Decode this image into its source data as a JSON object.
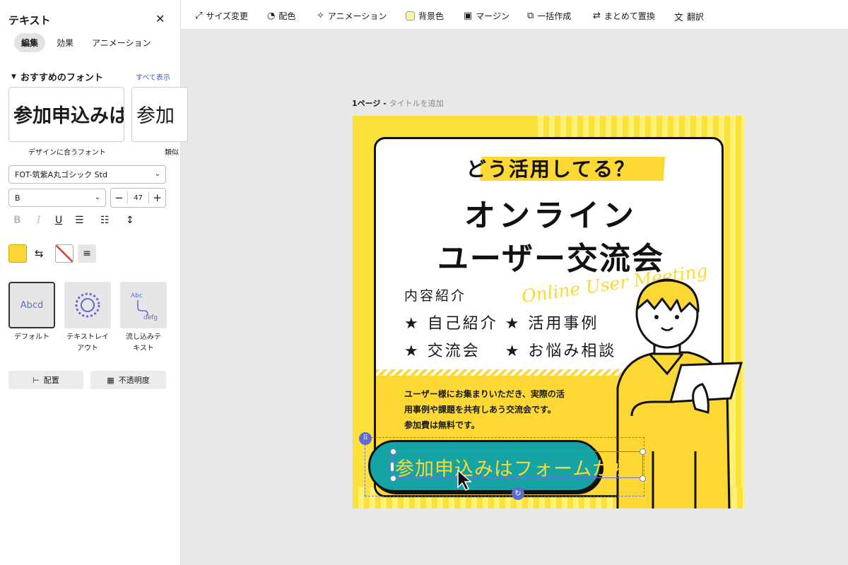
{
  "panel": {
    "title": "テキスト",
    "tabs": [
      "編集",
      "効果",
      "アニメーション"
    ],
    "section_title": "おすすめのフォント",
    "show_all": "すべて表示",
    "font_cards": [
      {
        "sample": "参加申込みは",
        "caption": "デザインに合うフォント"
      },
      {
        "sample": "参加",
        "caption": "類似"
      }
    ],
    "font_family": "FOT-筑紫A丸ゴシック Std",
    "font_weight": "B",
    "font_size": "47",
    "text_color": "#fdd835",
    "effects": [
      {
        "label": "デフォルト",
        "preview": "Abcd"
      },
      {
        "label": "テキストレイアウト",
        "preview": "ABCDEFGHIJKL"
      },
      {
        "label": "流し込みテキスト",
        "preview": "Abc defg"
      }
    ],
    "buttons": {
      "arrange": "配置",
      "opacity": "不透明度"
    }
  },
  "toolbar": [
    "サイズ変更",
    "配色",
    "アニメーション",
    "背景色",
    "マージン",
    "一括作成",
    "まとめて置換",
    "翻訳"
  ],
  "page": {
    "number": "1ページ -",
    "title_placeholder": "タイトルを追加"
  },
  "design": {
    "tagline": "どう活用してる？",
    "title1": "オンライン",
    "title2": "ユーザー交流会",
    "script": "Online User Meeting",
    "section": "内容紹介",
    "items1": "★ 自己紹介 ★ 活用事例",
    "items2": "★ 交流会　 ★ お悩み相談",
    "desc": [
      "ユーザー様にお集まりいただき、実際の活",
      "用事例や課題を共有しあう交流会です。",
      "参加費は無料です。"
    ],
    "cta": "参加申込みはフォームから"
  },
  "colors": {
    "accent": "#5e6bd6",
    "yellow": "#fdd835",
    "teal": "#16a3a3"
  }
}
